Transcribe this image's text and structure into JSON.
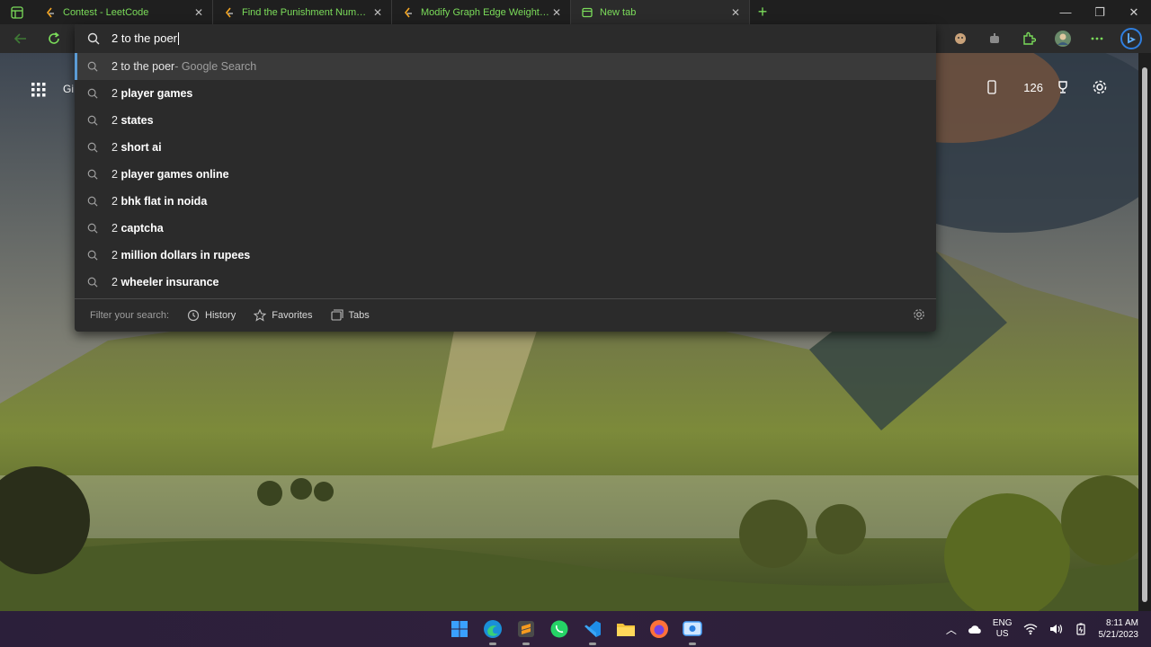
{
  "tabs": [
    {
      "title": "Contest - LeetCode",
      "active": false
    },
    {
      "title": "Find the Punishment Number of",
      "active": false
    },
    {
      "title": "Modify Graph Edge Weights - Le",
      "active": false
    },
    {
      "title": "New tab",
      "active": true
    }
  ],
  "omnibox": {
    "query": "2 to the poer",
    "top": {
      "text": "2 to the poer",
      "source": " - Google Search"
    },
    "suggestions": [
      {
        "prefix": "2 ",
        "bold": "player games"
      },
      {
        "prefix": "2 ",
        "bold": "states"
      },
      {
        "prefix": "2 ",
        "bold": "short ai"
      },
      {
        "prefix": "2 ",
        "bold": "player games online"
      },
      {
        "prefix": "2 ",
        "bold": "bhk flat in noida"
      },
      {
        "prefix": "2 ",
        "bold": "captcha"
      },
      {
        "prefix": "2 ",
        "bold": "million dollars in rupees"
      },
      {
        "prefix": "2 ",
        "bold": "wheeler insurance"
      }
    ],
    "filter": {
      "label": "Filter your search:",
      "history": "History",
      "favorites": "Favorites",
      "tabs": "Tabs"
    }
  },
  "ntp": {
    "rewards_points": "126",
    "apps_partial": "Gi"
  },
  "tray": {
    "lang_line1": "ENG",
    "lang_line2": "US",
    "time": "8:11 AM",
    "date": "5/21/2023"
  },
  "colors": {
    "accent_green": "#7bdc5a",
    "selection_border": "#5b9bd5"
  }
}
